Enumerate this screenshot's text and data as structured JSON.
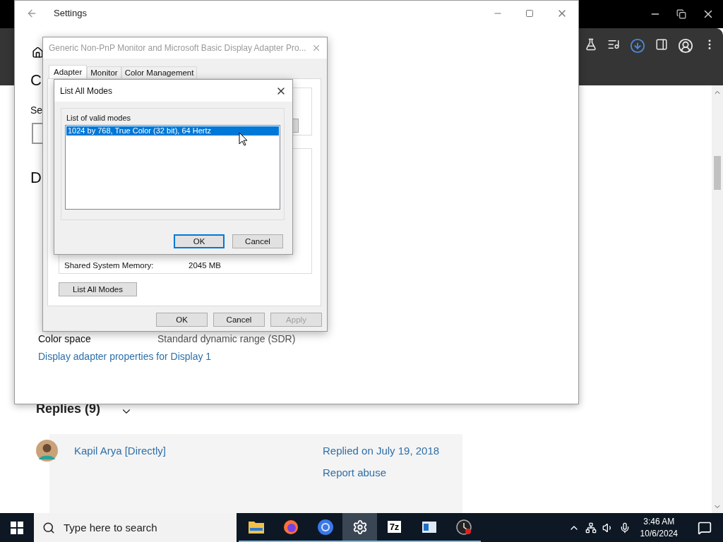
{
  "browser": {
    "page": {
      "replies_heading": "Replies (9)",
      "reply": {
        "author": "Kapil Arya [Directly]",
        "date": "Replied on July 19, 2018",
        "report": "Report abuse"
      }
    }
  },
  "settings_window": {
    "title": "Settings",
    "partial_heading": "C",
    "partial_label": "Se",
    "partial_section": "D",
    "rows": [
      {
        "label": "Color space",
        "value": "Standard dynamic range (SDR)"
      }
    ],
    "link": "Display adapter properties for Display 1"
  },
  "properties_dialog": {
    "title": "Generic Non-PnP Monitor and Microsoft Basic Display Adapter Pro...",
    "tabs": [
      {
        "label": "Adapter",
        "selected": true
      },
      {
        "label": "Monitor",
        "selected": false
      },
      {
        "label": "Color Management",
        "selected": false
      }
    ],
    "memory": {
      "label": "Shared System Memory:",
      "value": "2045 MB"
    },
    "list_button": "List All Modes",
    "buttons": [
      {
        "label": "OK",
        "disabled": false
      },
      {
        "label": "Cancel",
        "disabled": false
      },
      {
        "label": "Apply",
        "disabled": true
      }
    ]
  },
  "modes_dialog": {
    "title": "List All Modes",
    "group": "List of valid modes",
    "modes": [
      {
        "text": "1024 by 768, True Color (32 bit), 64 Hertz",
        "selected": true
      }
    ],
    "buttons": [
      {
        "label": "OK",
        "default": true
      },
      {
        "label": "Cancel",
        "default": false
      }
    ]
  },
  "taskbar": {
    "search_placeholder": "Type here to search",
    "apps": [
      {
        "kind": "folder",
        "selected": false
      },
      {
        "kind": "fox",
        "selected": false
      },
      {
        "kind": "globe",
        "selected": false
      },
      {
        "kind": "gear",
        "selected": true
      },
      {
        "kind": "archive",
        "label": "7z",
        "selected": false
      },
      {
        "kind": "window",
        "selected": false
      },
      {
        "kind": "clock",
        "selected": false
      }
    ],
    "time": "3:46 AM",
    "date": "10/6/2024"
  }
}
